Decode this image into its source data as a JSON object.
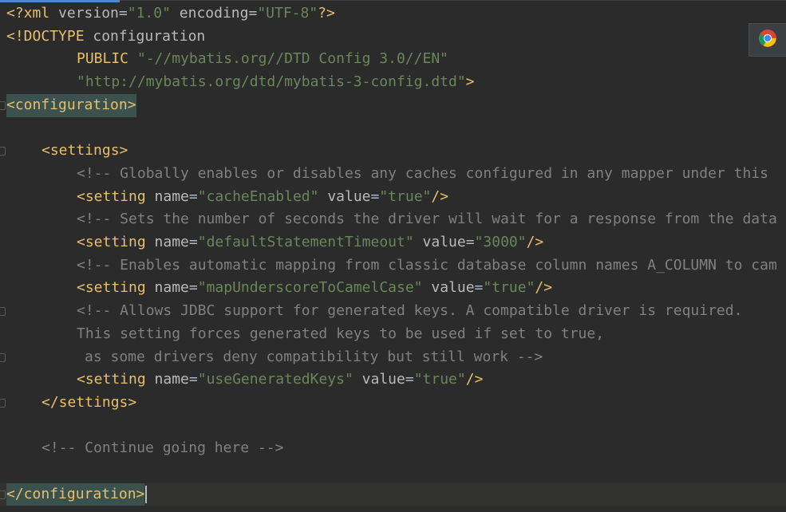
{
  "editor": {
    "lines": [
      {
        "segs": [
          {
            "t": "<?xml ",
            "c": "t-pi"
          },
          {
            "t": "version",
            "c": "t-attr"
          },
          {
            "t": "=",
            "c": "t-plain"
          },
          {
            "t": "\"1.0\"",
            "c": "t-val"
          },
          {
            "t": " ",
            "c": "t-plain"
          },
          {
            "t": "encoding",
            "c": "t-attr"
          },
          {
            "t": "=",
            "c": "t-plain"
          },
          {
            "t": "\"UTF-8\"",
            "c": "t-val"
          },
          {
            "t": "?>",
            "c": "t-pi"
          }
        ]
      },
      {
        "segs": [
          {
            "t": "<!DOCTYPE ",
            "c": "t-tag"
          },
          {
            "t": "configuration",
            "c": "t-attr"
          }
        ]
      },
      {
        "segs": [
          {
            "t": "PUBLIC ",
            "c": "t-tag"
          },
          {
            "t": "\"-//mybatis.org//DTD Config 3.0//EN\"",
            "c": "t-val"
          }
        ]
      },
      {
        "segs": [
          {
            "t": "\"http://mybatis.org/dtd/mybatis-3-config.dtd\"",
            "c": "t-val"
          },
          {
            "t": ">",
            "c": "t-tag"
          }
        ]
      },
      {
        "segs": [
          {
            "t": "<configuration>",
            "c": "t-tag"
          }
        ]
      },
      {
        "segs": []
      },
      {
        "segs": [
          {
            "t": "<settings>",
            "c": "t-tag"
          }
        ]
      },
      {
        "segs": [
          {
            "t": "<!-- Globally enables or disables any caches configured in any mapper under this",
            "c": "t-cmt"
          }
        ]
      },
      {
        "segs": [
          {
            "t": "<setting ",
            "c": "t-tag"
          },
          {
            "t": "name",
            "c": "t-attr"
          },
          {
            "t": "=",
            "c": "t-plain"
          },
          {
            "t": "\"cacheEnabled\"",
            "c": "t-val"
          },
          {
            "t": " ",
            "c": "t-plain"
          },
          {
            "t": "value",
            "c": "t-attr"
          },
          {
            "t": "=",
            "c": "t-plain"
          },
          {
            "t": "\"true\"",
            "c": "t-val"
          },
          {
            "t": "/>",
            "c": "t-tag"
          }
        ]
      },
      {
        "segs": [
          {
            "t": "<!-- Sets the number of seconds the driver will wait for a response from the data",
            "c": "t-cmt"
          }
        ]
      },
      {
        "segs": [
          {
            "t": "<setting ",
            "c": "t-tag"
          },
          {
            "t": "name",
            "c": "t-attr"
          },
          {
            "t": "=",
            "c": "t-plain"
          },
          {
            "t": "\"defaultStatementTimeout\"",
            "c": "t-val"
          },
          {
            "t": " ",
            "c": "t-plain"
          },
          {
            "t": "value",
            "c": "t-attr"
          },
          {
            "t": "=",
            "c": "t-plain"
          },
          {
            "t": "\"3000\"",
            "c": "t-val"
          },
          {
            "t": "/>",
            "c": "t-tag"
          }
        ]
      },
      {
        "segs": [
          {
            "t": "<!-- Enables automatic mapping from classic database column names A_COLUMN to cam",
            "c": "t-cmt"
          }
        ]
      },
      {
        "segs": [
          {
            "t": "<setting ",
            "c": "t-tag"
          },
          {
            "t": "name",
            "c": "t-attr"
          },
          {
            "t": "=",
            "c": "t-plain"
          },
          {
            "t": "\"mapUnderscoreToCamelCase\"",
            "c": "t-val"
          },
          {
            "t": " ",
            "c": "t-plain"
          },
          {
            "t": "value",
            "c": "t-attr"
          },
          {
            "t": "=",
            "c": "t-plain"
          },
          {
            "t": "\"true\"",
            "c": "t-val"
          },
          {
            "t": "/>",
            "c": "t-tag"
          }
        ]
      },
      {
        "segs": [
          {
            "t": "<!-- Allows JDBC support for generated keys. A compatible driver is required.",
            "c": "t-cmt"
          }
        ]
      },
      {
        "segs": [
          {
            "t": "This setting forces generated keys to be used if set to true,",
            "c": "t-cmt"
          }
        ]
      },
      {
        "segs": [
          {
            "t": "as some drivers deny compatibility but still work -->",
            "c": "t-cmt"
          }
        ]
      },
      {
        "segs": [
          {
            "t": "<setting ",
            "c": "t-tag"
          },
          {
            "t": "name",
            "c": "t-attr"
          },
          {
            "t": "=",
            "c": "t-plain"
          },
          {
            "t": "\"useGeneratedKeys\"",
            "c": "t-val"
          },
          {
            "t": " ",
            "c": "t-plain"
          },
          {
            "t": "value",
            "c": "t-attr"
          },
          {
            "t": "=",
            "c": "t-plain"
          },
          {
            "t": "\"true\"",
            "c": "t-val"
          },
          {
            "t": "/>",
            "c": "t-tag"
          }
        ]
      },
      {
        "segs": [
          {
            "t": "</settings>",
            "c": "t-tag"
          }
        ]
      },
      {
        "segs": []
      },
      {
        "segs": [
          {
            "t": "<!-- Continue going here -->",
            "c": "t-cmt"
          }
        ]
      },
      {
        "segs": []
      },
      {
        "segs": [
          {
            "t": "</configuration>",
            "c": "t-tag"
          }
        ]
      }
    ]
  },
  "chrome_button": {
    "icon": "chrome-icon"
  }
}
